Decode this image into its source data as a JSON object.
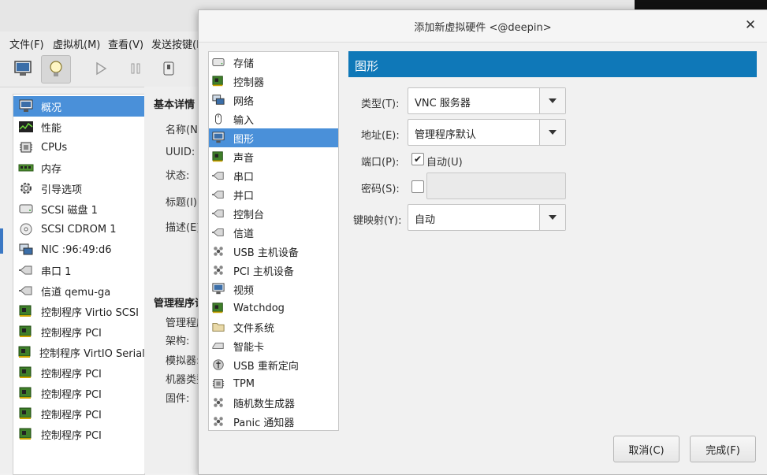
{
  "background_app": {
    "menu": [
      "文件(F)",
      "虚拟机(M)",
      "查看(V)",
      "发送按键(K"
    ],
    "hardware_list": [
      {
        "label": "概况",
        "icon": "monitor-icon",
        "selected": true
      },
      {
        "label": "性能",
        "icon": "performance-graph-icon",
        "selected": false
      },
      {
        "label": "CPUs",
        "icon": "cpu-icon",
        "selected": false
      },
      {
        "label": "内存",
        "icon": "memory-icon",
        "selected": false
      },
      {
        "label": "引导选项",
        "icon": "gear-icon",
        "selected": false
      },
      {
        "label": "SCSI 磁盘 1",
        "icon": "disk-icon",
        "selected": false
      },
      {
        "label": "SCSI CDROM 1",
        "icon": "cdrom-icon",
        "selected": false
      },
      {
        "label": "NIC :96:49:d6",
        "icon": "network-icon",
        "selected": false
      },
      {
        "label": "串口 1",
        "icon": "serial-icon",
        "selected": false
      },
      {
        "label": "信道 qemu-ga",
        "icon": "channel-icon",
        "selected": false
      },
      {
        "label": "控制程序 Virtio SCSI",
        "icon": "controller-icon",
        "selected": false
      },
      {
        "label": "控制程序 PCI",
        "icon": "controller-icon",
        "selected": false
      },
      {
        "label": "控制程序 VirtIO Serial",
        "icon": "controller-icon",
        "selected": false
      },
      {
        "label": "控制程序 PCI",
        "icon": "controller-icon",
        "selected": false
      },
      {
        "label": "控制程序 PCI",
        "icon": "controller-icon",
        "selected": false
      },
      {
        "label": "控制程序 PCI",
        "icon": "controller-icon",
        "selected": false
      },
      {
        "label": "控制程序 PCI",
        "icon": "controller-icon",
        "selected": false
      }
    ],
    "details": {
      "basic_heading": "基本详情",
      "basic_labels": [
        "名称(N)",
        "UUID:",
        "状态:",
        "标题(I):",
        "描述(E)"
      ],
      "hypervisor_heading": "管理程序详",
      "hypervisor_labels": [
        "管理程序",
        "架构:",
        "模拟器:",
        "机器类型",
        "固件:"
      ]
    }
  },
  "dialog": {
    "title": "添加新虚拟硬件 <@deepin>",
    "close_glyph": "✕",
    "device_list": [
      {
        "label": "存储",
        "icon": "storage-icon",
        "selected": false
      },
      {
        "label": "控制器",
        "icon": "controller-icon",
        "selected": false
      },
      {
        "label": "网络",
        "icon": "network-icon",
        "selected": false
      },
      {
        "label": "输入",
        "icon": "mouse-icon",
        "selected": false
      },
      {
        "label": "图形",
        "icon": "display-icon",
        "selected": true
      },
      {
        "label": "声音",
        "icon": "sound-card-icon",
        "selected": false
      },
      {
        "label": "串口",
        "icon": "serial-icon",
        "selected": false
      },
      {
        "label": "并口",
        "icon": "parallel-icon",
        "selected": false
      },
      {
        "label": "控制台",
        "icon": "console-icon",
        "selected": false
      },
      {
        "label": "信道",
        "icon": "channel-icon",
        "selected": false
      },
      {
        "label": "USB 主机设备",
        "icon": "usb-icon",
        "selected": false
      },
      {
        "label": "PCI 主机设备",
        "icon": "pci-icon",
        "selected": false
      },
      {
        "label": "视频",
        "icon": "video-icon",
        "selected": false
      },
      {
        "label": "Watchdog",
        "icon": "watchdog-icon",
        "selected": false
      },
      {
        "label": "文件系统",
        "icon": "folder-icon",
        "selected": false
      },
      {
        "label": "智能卡",
        "icon": "smartcard-icon",
        "selected": false
      },
      {
        "label": "USB 重新定向",
        "icon": "usb-redirect-icon",
        "selected": false
      },
      {
        "label": "TPM",
        "icon": "chip-icon",
        "selected": false
      },
      {
        "label": "随机数生成器",
        "icon": "rng-icon",
        "selected": false
      },
      {
        "label": "Panic 通知器",
        "icon": "panic-icon",
        "selected": false
      }
    ],
    "section_title": "图形",
    "form": {
      "type_label": "类型(T):",
      "type_value": "VNC 服务器",
      "address_label": "地址(E):",
      "address_value": "管理程序默认",
      "port_label": "端口(P):",
      "port_auto_label": "自动(U)",
      "port_auto_checked": true,
      "password_label": "密码(S):",
      "password_checked": false,
      "password_value": "",
      "keymap_label": "键映射(Y):",
      "keymap_value": "自动"
    },
    "buttons": {
      "cancel": "取消(C)",
      "finish": "完成(F)"
    }
  },
  "colors": {
    "selection": "#4a90d9",
    "section_header": "#0f78b8"
  }
}
